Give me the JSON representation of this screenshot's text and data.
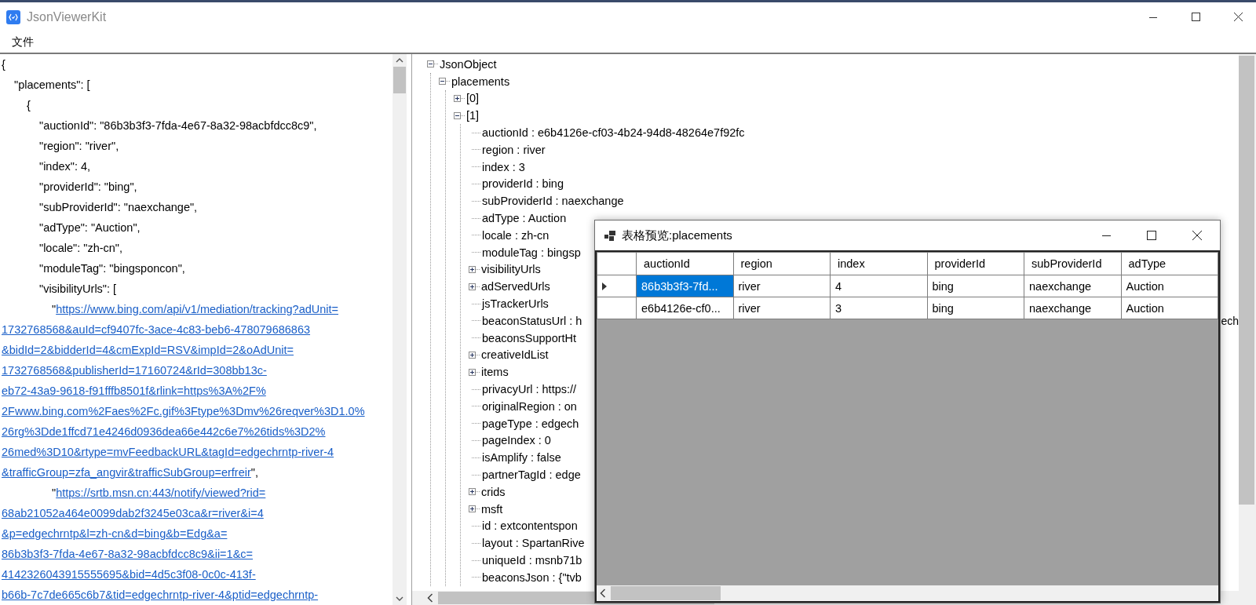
{
  "window": {
    "title": "JsonViewerKit"
  },
  "menu": [
    {
      "label": "文件"
    }
  ],
  "json_text": [
    {
      "kind": "code",
      "text": "{",
      "children": [
        {
          "kind": "code",
          "text": "\"placements\": [",
          "children": [
            {
              "kind": "code",
              "text": "{",
              "children": [
                {
                  "kind": "code",
                  "text": "\"auctionId\": \"86b3b3f3-7fda-4e67-8a32-98acbfdcc8c9\","
                },
                {
                  "kind": "code",
                  "text": "\"region\": \"river\","
                },
                {
                  "kind": "code",
                  "text": "\"index\": 4,"
                },
                {
                  "kind": "code",
                  "text": "\"providerId\": \"bing\","
                },
                {
                  "kind": "code",
                  "text": "\"subProviderId\": \"naexchange\","
                },
                {
                  "kind": "code",
                  "text": "\"adType\": \"Auction\","
                },
                {
                  "kind": "code",
                  "text": "\"locale\": \"zh-cn\","
                },
                {
                  "kind": "code",
                  "text": "\"moduleTag\": \"bingsponcon\","
                },
                {
                  "kind": "code",
                  "text": "\"visibilityUrls\": [",
                  "children": [
                    {
                      "kind": "link",
                      "prefix": "\"",
                      "lines": [
                        "https://www.bing.com/api/v1/mediation/tracking?adUnit=",
                        "1732768568&auId=cf9407fc-3ace-4c83-beb6-478079686863",
                        "&bidId=2&bidderId=4&cmExpId=RSV&impId=2&oAdUnit=",
                        "1732768568&publisherId=17160724&rId=308bb13c-",
                        "eb72-43a9-9618-f91fffb8501f&rlink=https%3A%2F%",
                        "2Fwww.bing.com%2Faes%2Fc.gif%3Ftype%3Dmv%26reqver%3D1.0%",
                        "26rg%3Dde1ffcd71e4246d0936dea66e442c6e7%26tids%3D2%",
                        "26med%3D10&rtype=mvFeedbackURL&tagId=edgechrntp-river-4",
                        "&trafficGroup=zfa_angvir&trafficSubGroup=erfreir"
                      ],
                      "suffix": "\","
                    },
                    {
                      "kind": "link",
                      "prefix": "\"",
                      "lines": [
                        "https://srtb.msn.cn:443/notify/viewed?rid=",
                        "68ab21052a464e0099dab2f3245e03ca&r=river&i=4",
                        "&p=edgechrntp&l=zh-cn&d=bing&b=Edg&a=",
                        "86b3b3f3-7fda-4e67-8a32-98acbfdcc8c9&ii=1&c=",
                        "4142326043915555695&bid=4d5c3f08-0c0c-413f-",
                        "b66b-7c7de665c6b7&tid=edgechrntp-river-4&ptid=edgechrntp-"
                      ]
                    }
                  ]
                }
              ]
            }
          ]
        }
      ]
    }
  ],
  "tree": {
    "label": "JsonObject",
    "expanded": true,
    "children": [
      {
        "label": "placements",
        "expanded": true,
        "children": [
          {
            "label": "[0]",
            "expanded": false
          },
          {
            "label": "[1]",
            "expanded": true,
            "children": [
              {
                "label": "auctionId : e6b4126e-cf03-4b24-94d8-48264e7f92fc"
              },
              {
                "label": "region : river"
              },
              {
                "label": "index : 3"
              },
              {
                "label": "providerId : bing"
              },
              {
                "label": "subProviderId : naexchange"
              },
              {
                "label": "adType : Auction"
              },
              {
                "label": "locale : zh-cn"
              },
              {
                "label": "moduleTag : bingsp"
              },
              {
                "label": "visibilityUrls",
                "expanded": false
              },
              {
                "label": "adServedUrls",
                "expanded": false
              },
              {
                "label": "jsTrackerUrls"
              },
              {
                "label": "beaconStatusUrl : h",
                "tail": "ech"
              },
              {
                "label": "beaconsSupportHt"
              },
              {
                "label": "creativeIdList",
                "expanded": false
              },
              {
                "label": "items",
                "expanded": false
              },
              {
                "label": "privacyUrl : https://"
              },
              {
                "label": "originalRegion : on"
              },
              {
                "label": "pageType : edgech"
              },
              {
                "label": "pageIndex : 0"
              },
              {
                "label": "isAmplify : false"
              },
              {
                "label": "partnerTagId : edge"
              },
              {
                "label": "crids",
                "expanded": false
              },
              {
                "label": "msft",
                "expanded": false
              },
              {
                "label": "id : extcontentspon"
              },
              {
                "label": "layout : SpartanRive"
              },
              {
                "label": "uniqueId : msnb71b"
              },
              {
                "label": "beaconsJson : {\"tvb"
              }
            ]
          }
        ]
      }
    ]
  },
  "preview_window": {
    "title": "表格预览:placements",
    "columns": [
      "auctionId",
      "region",
      "index",
      "providerId",
      "subProviderId",
      "adType"
    ],
    "rows": [
      {
        "current": true,
        "cells": [
          {
            "text": "86b3b3f3-7fd...",
            "selected": true
          },
          {
            "text": "river",
            "selected": false
          },
          {
            "text": "4",
            "selected": false
          },
          {
            "text": "bing",
            "selected": false
          },
          {
            "text": "naexchange",
            "selected": false
          },
          {
            "text": "Auction",
            "selected": false
          }
        ]
      },
      {
        "current": false,
        "cells": [
          {
            "text": "e6b4126e-cf0...",
            "selected": false
          },
          {
            "text": "river",
            "selected": false
          },
          {
            "text": "3",
            "selected": false
          },
          {
            "text": "bing",
            "selected": false
          },
          {
            "text": "naexchange",
            "selected": false
          },
          {
            "text": "Auction",
            "selected": false
          }
        ]
      }
    ]
  }
}
